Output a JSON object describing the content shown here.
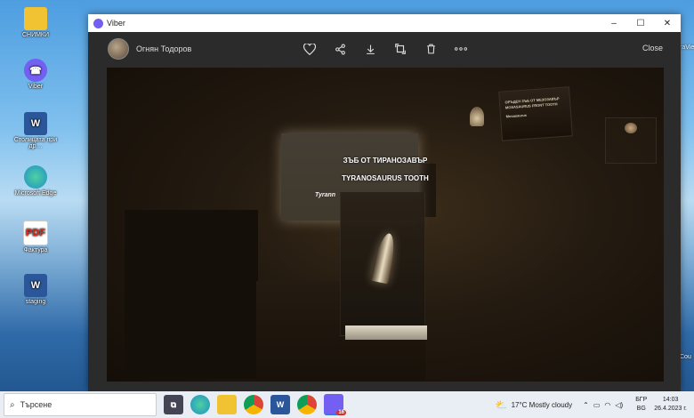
{
  "desktop": {
    "icons": [
      {
        "label": "СНИМКИ",
        "icon": "folder-icon",
        "color": "#f1c232"
      },
      {
        "label": "Viber",
        "icon": "viber-icon",
        "color": "#7360f2"
      },
      {
        "label": "Столицата при др…",
        "icon": "word-icon",
        "color": "#2b579a"
      },
      {
        "label": "Microsoft Edge",
        "icon": "edge-icon",
        "color": "#1e90c8"
      },
      {
        "label": "Фактура",
        "icon": "pdf-icon",
        "color": "#d93025"
      },
      {
        "label": "staging",
        "icon": "word-icon",
        "color": "#2b579a"
      }
    ],
    "right_edge_fragments": [
      "raVie",
      "Cou"
    ]
  },
  "window": {
    "title": "Viber",
    "controls": {
      "minimize": "–",
      "maximize": "☐",
      "close": "✕"
    }
  },
  "viewer": {
    "sender": "Огнян Тодоров",
    "close_label": "Close",
    "tools": [
      "heart-icon",
      "share-icon",
      "download-icon",
      "forward-icon",
      "delete-icon",
      "more-icon"
    ]
  },
  "photo": {
    "sign_line1": "ЗЪБ ОТ ТИРАНОЗАВЪР",
    "sign_line2": "TYRANOSAURUS TOOTH",
    "sign_line3": "Tyrann",
    "card_right_line1": "ОРЪДЕН ЗЪБ ОТ МЕЗОЗАВЪР",
    "card_right_line2": "MOSASAURUS FRONT TOOTH",
    "card_right_line3": "Mosasaurus"
  },
  "taskbar": {
    "search_placeholder": "Търсене",
    "weather": "17°C  Mostly cloudy",
    "language": "БГР",
    "language_sub": "BG",
    "time": "14:03",
    "date": "26.4.2023 г.",
    "viber_badge": "16"
  }
}
